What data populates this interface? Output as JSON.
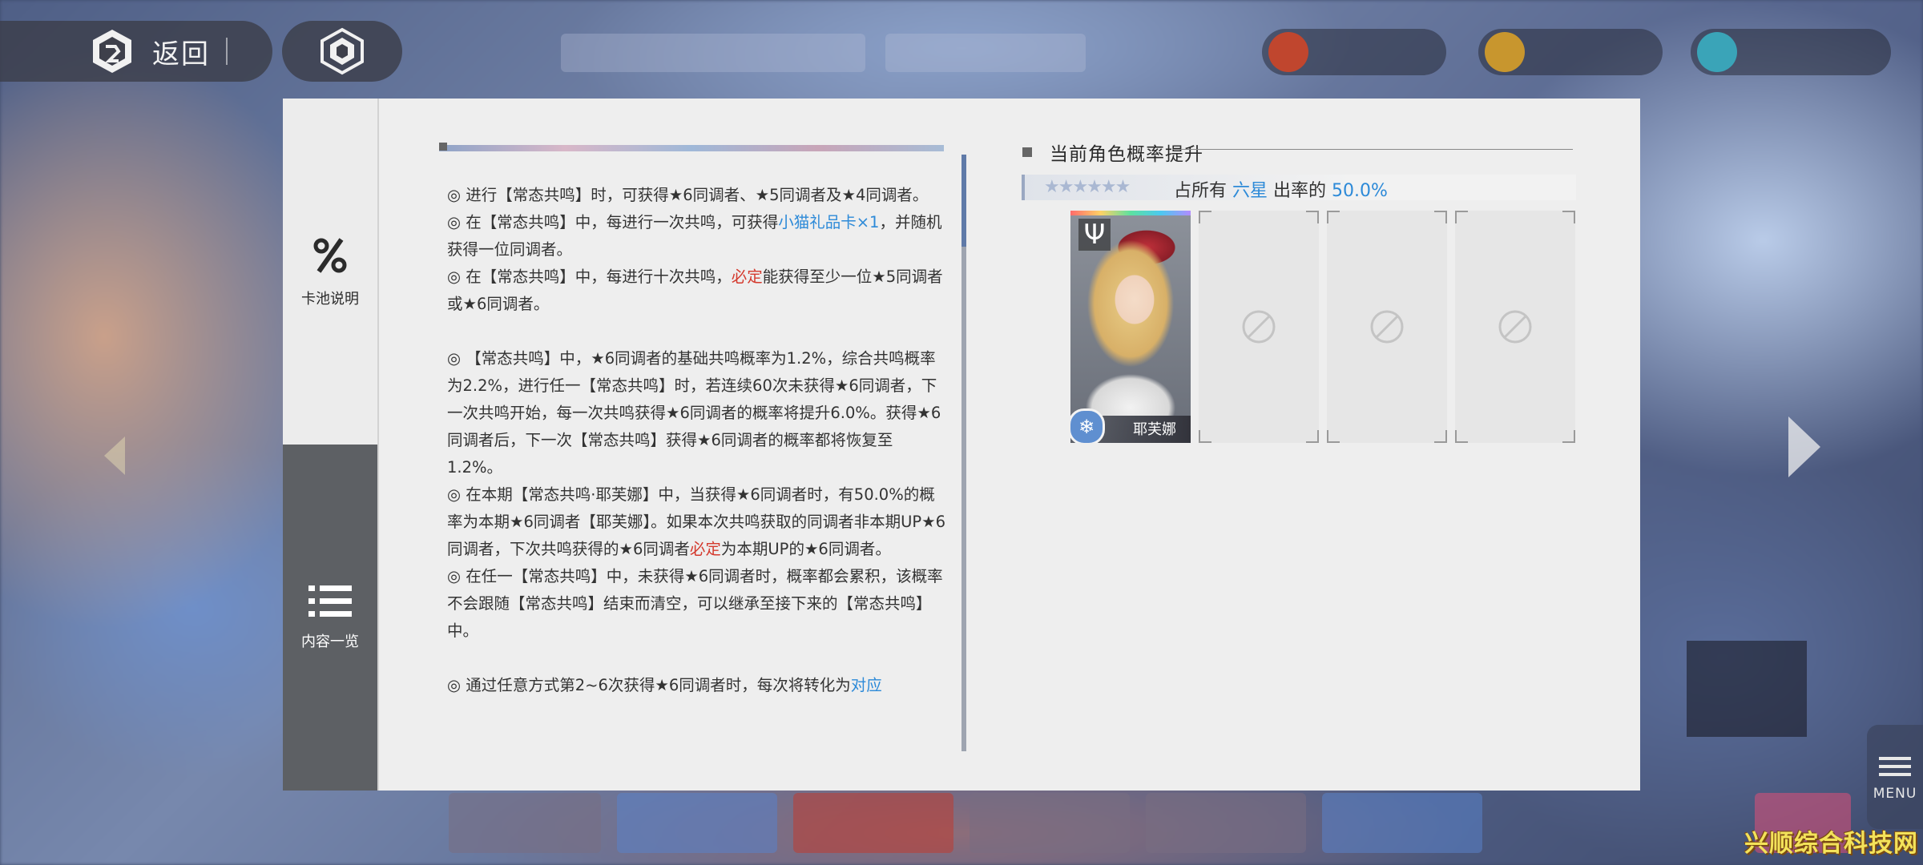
{
  "topbar": {
    "back_label": "返回"
  },
  "sidebar": {
    "pool_info_label": "卡池说明",
    "content_list_label": "内容一览"
  },
  "rules": [
    [
      {
        "t": "◎ 进行【常态共鸣】时，可获得★6同调者、★5同调者及★4同调者。"
      }
    ],
    [
      {
        "t": "◎ 在【常态共鸣】中，每进行一次共鸣，可获得"
      },
      {
        "t": "小猫礼品卡×1",
        "c": "blue"
      },
      {
        "t": "，并随机获得一位同调者。"
      }
    ],
    [
      {
        "t": "◎ 在【常态共鸣】中，每进行十次共鸣，"
      },
      {
        "t": "必定",
        "c": "red"
      },
      {
        "t": "能获得至少一位★5同调者或★6同调者。"
      }
    ],
    [],
    [
      {
        "t": "◎ 【常态共鸣】中，★6同调者的基础共鸣概率为1.2%，综合共鸣概率为2.2%，进行任一【常态共鸣】时，若连续60次未获得★6同调者，下一次共鸣开始，每一次共鸣获得★6同调者的概率将提升6.0%。获得★6同调者后，下一次【常态共鸣】获得★6同调者的概率都将恢复至1.2%。"
      }
    ],
    [
      {
        "t": "◎ 在本期【常态共鸣·耶芙娜】中，当获得★6同调者时，有50.0%的概率为本期★6同调者【耶芙娜】。如果本次共鸣获取的同调者非本期UP★6同调者，下次共鸣获得的★6同调者"
      },
      {
        "t": "必定",
        "c": "red"
      },
      {
        "t": "为本期UP的★6同调者。"
      }
    ],
    [
      {
        "t": "◎ 在任一【常态共鸣】中，未获得★6同调者时，概率都会累积，该概率不会跟随【常态共鸣】结束而清空，可以继承至接下来的【常态共鸣】中。"
      }
    ],
    [],
    [
      {
        "t": "◎ 通过任意方式第2~6次获得★6同调者时，每次将转化为"
      },
      {
        "t": "对应",
        "c": "blue"
      }
    ]
  ],
  "rate_panel": {
    "title": "当前角色概率提升",
    "stars": "★★★★★★",
    "rate_prefix": "占所有",
    "rarity": "六星",
    "rate_middle": "出率的",
    "rate_value": "50.0%"
  },
  "featured": {
    "name": "耶芙娜",
    "class_icon": "trident-icon",
    "element_icon": "snowflake-icon"
  },
  "menu_label": "MENU",
  "watermark": "兴顺综合科技网",
  "colors": {
    "panel_bg": "#eeeeee",
    "nav_active": "#5d6064",
    "link_blue": "#2d8ad8",
    "alert_red": "#d43a2e"
  }
}
